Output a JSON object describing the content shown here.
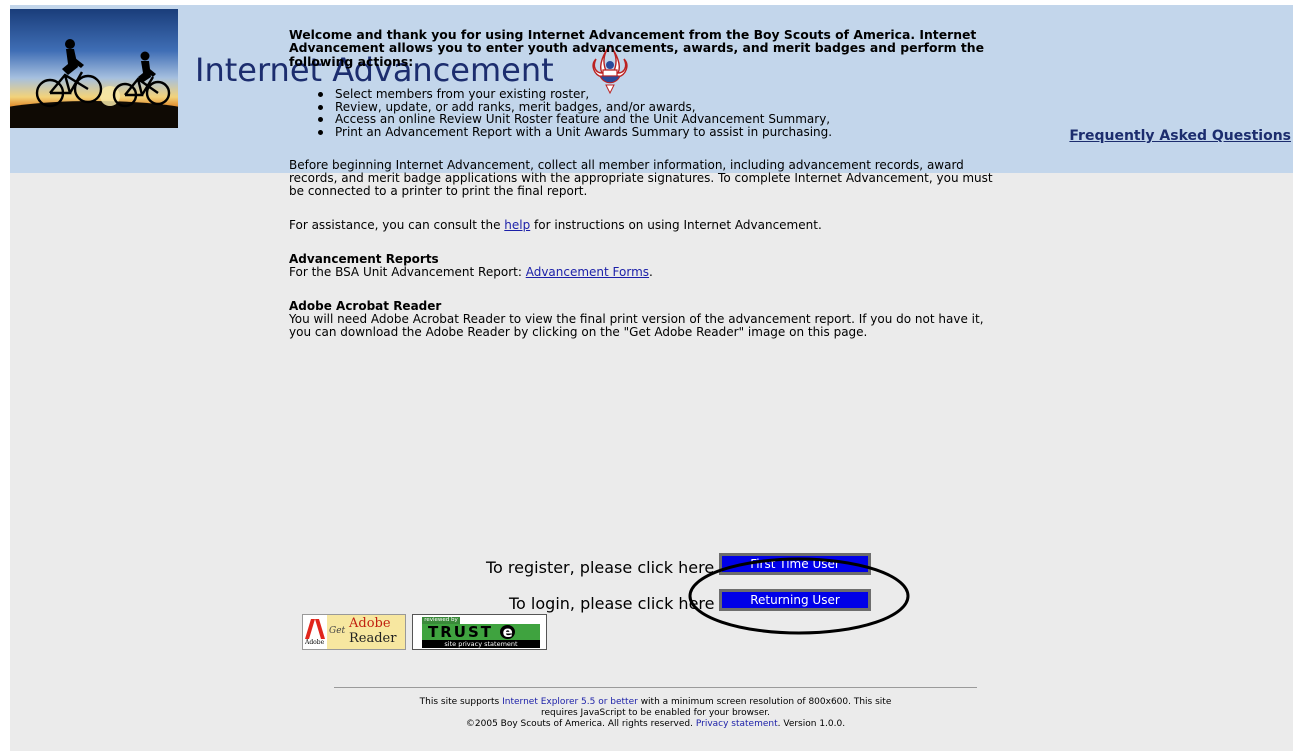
{
  "header": {
    "title": "Internet Advancement",
    "faq_link": "Frequently Asked Questions"
  },
  "main": {
    "intro": "Welcome and thank you for using Internet Advancement from the Boy Scouts of America. Internet Advancement allows you to enter youth advancements, awards, and merit badges and perform the following actions:",
    "actions": [
      "Select members from your existing roster,",
      "Review, update, or add ranks, merit badges, and/or awards,",
      "Access an online Review Unit Roster feature and the Unit Advancement Summary,",
      "Print an Advancement Report with a Unit Awards Summary to assist in purchasing."
    ],
    "before_beginning": "Before beginning Internet Advancement, collect all member information, including advancement records, award records, and merit badge applications with the appropriate signatures.  To complete Internet Advancement, you must be connected to a printer to print the final report.",
    "assistance": {
      "before": "For assistance, you can consult the ",
      "link": "help",
      "after": " for instructions on using Internet Advancement."
    },
    "reports": {
      "heading": "Advancement Reports",
      "text": "For the BSA Unit Advancement Report: ",
      "link": "Advancement Forms",
      "after": "."
    },
    "acrobat": {
      "heading": "Adobe Acrobat Reader",
      "text": "You will need Adobe Acrobat Reader to view the final print version of the advancement report. If you do not have it, you can download the Adobe Reader by clicking on the \"Get Adobe Reader\" image on this page."
    },
    "register": {
      "prompt": "To register, please click here -->",
      "button": "First Time User"
    },
    "login": {
      "prompt": "To login, please click here -->",
      "button": "Returning User"
    }
  },
  "badges": {
    "adobe": {
      "brand": "Adobe",
      "get": "Get",
      "product": "Adobe",
      "reader": "Reader"
    },
    "truste": {
      "top": "reviewed by",
      "logo": "TRUST",
      "logo_e": "e",
      "bottom": "site privacy statement"
    }
  },
  "footer": {
    "l1_a": "This site supports ",
    "l1_link": "Internet Explorer 5.5 or better",
    "l1_b": " with a minimum screen resolution of 800x600. This site",
    "l2": "requires JavaScript to be enabled for your browser.",
    "l3_a": "©2005 Boy Scouts of America. All rights reserved. ",
    "l3_link": "Privacy statement",
    "l3_b": ". Version 1.0.0."
  },
  "colors": {
    "header_bg": "#c3d6eb",
    "content_bg": "#ebebeb",
    "title": "#1c2d6e",
    "link": "#1b1fa8",
    "button_bg": "#0000e8"
  }
}
